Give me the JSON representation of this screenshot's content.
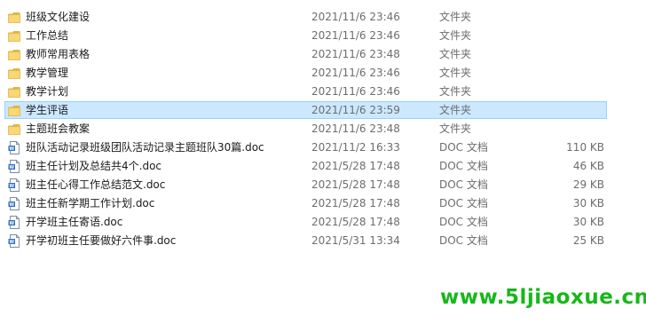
{
  "colors": {
    "folder": "#f8d775",
    "folder_dark": "#e0b548",
    "selection_bg": "#cce8ff",
    "selection_border": "#99d1ff",
    "doc_icon": "#2b6fc2",
    "watermark": "#16b81a"
  },
  "files": [
    {
      "name": "班级文化建设",
      "date": "2021/11/6 23:46",
      "type": "文件夹",
      "size": "",
      "icon": "folder-icon",
      "selected": false
    },
    {
      "name": "工作总结",
      "date": "2021/11/6 23:46",
      "type": "文件夹",
      "size": "",
      "icon": "folder-icon",
      "selected": false
    },
    {
      "name": "教师常用表格",
      "date": "2021/11/6 23:48",
      "type": "文件夹",
      "size": "",
      "icon": "folder-icon",
      "selected": false
    },
    {
      "name": "教学管理",
      "date": "2021/11/6 23:46",
      "type": "文件夹",
      "size": "",
      "icon": "folder-icon",
      "selected": false
    },
    {
      "name": "教学计划",
      "date": "2021/11/6 23:46",
      "type": "文件夹",
      "size": "",
      "icon": "folder-icon",
      "selected": false
    },
    {
      "name": "学生评语",
      "date": "2021/11/6 23:59",
      "type": "文件夹",
      "size": "",
      "icon": "folder-icon",
      "selected": true
    },
    {
      "name": "主题班会教案",
      "date": "2021/11/6 23:48",
      "type": "文件夹",
      "size": "",
      "icon": "folder-icon",
      "selected": false
    },
    {
      "name": "班队活动记录班级团队活动记录主题班队30篇.doc",
      "date": "2021/11/2 16:33",
      "type": "DOC 文档",
      "size": "110 KB",
      "icon": "doc-icon",
      "selected": false
    },
    {
      "name": "班主任计划及总结共4个.doc",
      "date": "2021/5/28 17:48",
      "type": "DOC 文档",
      "size": "46 KB",
      "icon": "doc-icon",
      "selected": false
    },
    {
      "name": "班主任心得工作总结范文.doc",
      "date": "2021/5/28 17:48",
      "type": "DOC 文档",
      "size": "29 KB",
      "icon": "doc-icon",
      "selected": false
    },
    {
      "name": "班主任新学期工作计划.doc",
      "date": "2021/5/28 17:48",
      "type": "DOC 文档",
      "size": "30 KB",
      "icon": "doc-icon",
      "selected": false
    },
    {
      "name": "开学班主任寄语.doc",
      "date": "2021/5/28 17:48",
      "type": "DOC 文档",
      "size": "30 KB",
      "icon": "doc-icon",
      "selected": false
    },
    {
      "name": "开学初班主任要做好六件事.doc",
      "date": "2021/5/31 13:34",
      "type": "DOC 文档",
      "size": "25 KB",
      "icon": "doc-icon",
      "selected": false
    }
  ],
  "watermark": "www.5ljiaoxue.cn"
}
